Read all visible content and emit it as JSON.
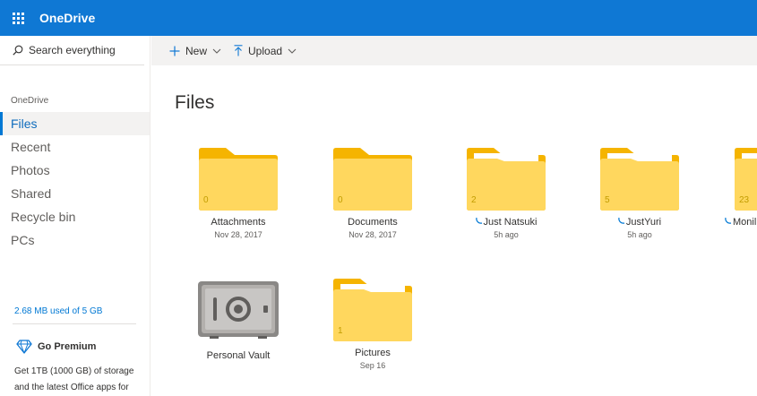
{
  "app": {
    "title": "OneDrive"
  },
  "search": {
    "placeholder": "Search everything"
  },
  "nav": {
    "heading": "OneDrive",
    "items": [
      {
        "label": "Files",
        "active": true
      },
      {
        "label": "Recent",
        "active": false
      },
      {
        "label": "Photos",
        "active": false
      },
      {
        "label": "Shared",
        "active": false
      },
      {
        "label": "Recycle bin",
        "active": false
      },
      {
        "label": "PCs",
        "active": false
      }
    ]
  },
  "storage": {
    "text": "2.68 MB used of 5 GB"
  },
  "premium": {
    "label": "Go Premium",
    "description": "Get 1TB (1000 GB) of storage and the latest Office apps for"
  },
  "toolbar": {
    "new_label": "New",
    "upload_label": "Upload"
  },
  "main": {
    "title": "Files",
    "items": [
      {
        "name": "Attachments",
        "meta": "Nov 28, 2017",
        "count": "0",
        "type": "folder"
      },
      {
        "name": "Documents",
        "meta": "Nov 28, 2017",
        "count": "0",
        "type": "folder"
      },
      {
        "name": "Just Natsuki",
        "meta": "5h ago",
        "count": "2",
        "type": "folder-with-files",
        "syncing": true
      },
      {
        "name": "JustYuri",
        "meta": "5h ago",
        "count": "5",
        "type": "folder-with-files",
        "syncing": true
      },
      {
        "name": "Monil",
        "meta": "",
        "count": "23",
        "type": "folder-with-files",
        "syncing": true
      },
      {
        "name": "Personal Vault",
        "meta": "",
        "type": "vault"
      },
      {
        "name": "Pictures",
        "meta": "Sep 16",
        "count": "1",
        "type": "folder-with-files"
      }
    ]
  },
  "colors": {
    "brand": "#0f78d4",
    "folder": "#ffd75e",
    "folder_tab": "#f5b400",
    "accent": "#0078d4"
  }
}
